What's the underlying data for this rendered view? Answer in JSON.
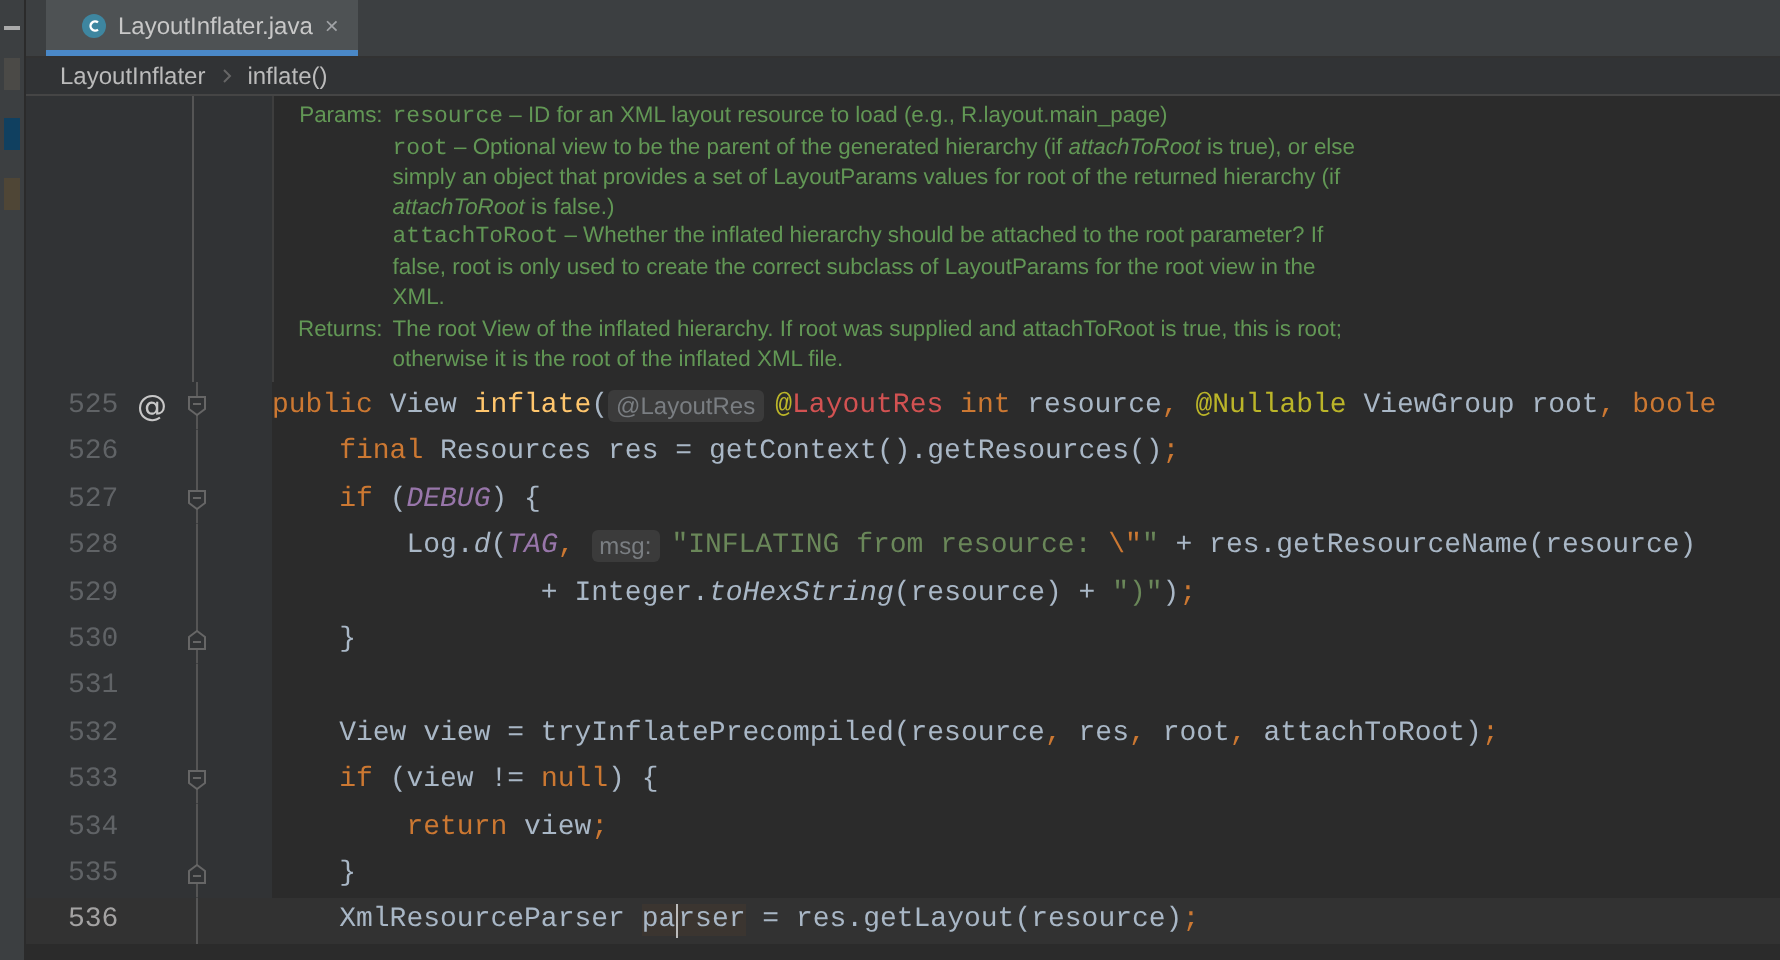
{
  "tab": {
    "title": "LayoutInflater.java",
    "close": "×",
    "selected": true
  },
  "breadcrumb": [
    "LayoutInflater",
    "inflate()"
  ],
  "doc": {
    "sections": [
      {
        "label": "Params:",
        "params": [
          {
            "name": "resource",
            "text": "– ID for an XML layout resource to load (e.g., R.layout.main_page)"
          },
          {
            "name": "root",
            "text": "– Optional view to be the parent of the generated hierarchy (if *attachToRoot* is true), or else simply an object that provides a set of LayoutParams values for root of the returned hierarchy (if *attachToRoot* is false.)"
          },
          {
            "name": "attachToRoot",
            "text": "– Whether the inflated hierarchy should be attached to the root parameter? If false, root is only used to create the correct subclass of LayoutParams for the root view in the XML."
          }
        ]
      },
      {
        "label": "Returns:",
        "params": [
          {
            "text": "The root View of the inflated hierarchy. If root was supplied and attachToRoot is true, this is root; otherwise it is the root of the inflated XML file."
          }
        ]
      }
    ]
  },
  "lines": [
    {
      "number": "525",
      "mark": "@",
      "fold_open": true,
      "fold_close": false,
      "current": false,
      "tokens": [
        {
          "text": "public ",
          "kind": "keyword"
        },
        {
          "text": "View ",
          "kind": "plain"
        },
        {
          "text": "inflate",
          "kind": "declaration"
        },
        {
          "text": "(",
          "kind": "plain"
        },
        {
          "text": "@LayoutRes",
          "kind": "hint"
        },
        {
          "text": "@",
          "kind": "annotation"
        },
        {
          "text": "LayoutRes",
          "kind": "resource-annotation"
        },
        {
          "text": " int ",
          "kind": "keyword"
        },
        {
          "text": "resource",
          "kind": "plain"
        },
        {
          "text": ", ",
          "kind": "keyword"
        },
        {
          "text": "@Nullable",
          "kind": "annotation"
        },
        {
          "text": " ViewGroup root",
          "kind": "plain"
        },
        {
          "text": ", boole",
          "kind": "keyword"
        }
      ]
    },
    {
      "number": "526",
      "fold_open": false,
      "fold_close": false,
      "current": false,
      "tokens": [
        {
          "text": "    final ",
          "kind": "keyword"
        },
        {
          "text": "Resources res = getContext().getResources()",
          "kind": "plain"
        },
        {
          "text": ";",
          "kind": "keyword"
        }
      ]
    },
    {
      "number": "527",
      "fold_open": true,
      "fold_close": false,
      "current": false,
      "tokens": [
        {
          "text": "    if ",
          "kind": "keyword"
        },
        {
          "text": "(",
          "kind": "plain"
        },
        {
          "text": "DEBUG",
          "kind": "constant"
        },
        {
          "text": ") {",
          "kind": "plain"
        }
      ]
    },
    {
      "number": "528",
      "fold_open": false,
      "fold_close": false,
      "current": false,
      "tokens": [
        {
          "text": "        Log.",
          "kind": "plain"
        },
        {
          "text": "d",
          "kind": "static"
        },
        {
          "text": "(",
          "kind": "plain"
        },
        {
          "text": "TAG",
          "kind": "constant"
        },
        {
          "text": ", ",
          "kind": "keyword"
        },
        {
          "text": "msg:",
          "kind": "hint"
        },
        {
          "text": "\"INFLATING from resource: ",
          "kind": "string"
        },
        {
          "text": "\\\"",
          "kind": "escape"
        },
        {
          "text": "\"",
          "kind": "string"
        },
        {
          "text": " + res.getResourceName(resource)",
          "kind": "plain"
        }
      ]
    },
    {
      "number": "529",
      "fold_open": false,
      "fold_close": false,
      "current": false,
      "tokens": [
        {
          "text": "                + Integer.",
          "kind": "plain"
        },
        {
          "text": "toHexString",
          "kind": "static"
        },
        {
          "text": "(resource) + ",
          "kind": "plain"
        },
        {
          "text": "\")\"",
          "kind": "string"
        },
        {
          "text": ")",
          "kind": "plain"
        },
        {
          "text": ";",
          "kind": "keyword"
        }
      ]
    },
    {
      "number": "530",
      "fold_open": false,
      "fold_close": true,
      "current": false,
      "tokens": [
        {
          "text": "    }",
          "kind": "plain"
        }
      ]
    },
    {
      "number": "531",
      "fold_open": false,
      "fold_close": false,
      "current": false
    },
    {
      "number": "532",
      "fold_open": false,
      "fold_close": false,
      "current": false,
      "tokens": [
        {
          "text": "    View view = tryInflatePrecompiled(resource",
          "kind": "plain"
        },
        {
          "text": ", ",
          "kind": "keyword"
        },
        {
          "text": "res",
          "kind": "plain"
        },
        {
          "text": ", ",
          "kind": "keyword"
        },
        {
          "text": "root",
          "kind": "plain"
        },
        {
          "text": ", ",
          "kind": "keyword"
        },
        {
          "text": "attachToRoot)",
          "kind": "plain"
        },
        {
          "text": ";",
          "kind": "keyword"
        }
      ]
    },
    {
      "number": "533",
      "fold_open": true,
      "fold_close": false,
      "current": false,
      "tokens": [
        {
          "text": "    if ",
          "kind": "keyword"
        },
        {
          "text": "(view != ",
          "kind": "plain"
        },
        {
          "text": "null",
          "kind": "keyword"
        },
        {
          "text": ") {",
          "kind": "plain"
        }
      ]
    },
    {
      "number": "534",
      "fold_open": false,
      "fold_close": false,
      "current": false,
      "tokens": [
        {
          "text": "        return ",
          "kind": "keyword"
        },
        {
          "text": "view",
          "kind": "plain"
        },
        {
          "text": ";",
          "kind": "keyword"
        }
      ]
    },
    {
      "number": "535",
      "fold_open": false,
      "fold_close": true,
      "current": false,
      "tokens": [
        {
          "text": "    }",
          "kind": "plain"
        }
      ]
    },
    {
      "number": "536",
      "fold_open": false,
      "fold_close": false,
      "current": true,
      "tokens": [
        {
          "text": "    XmlResourceParser ",
          "kind": "plain"
        },
        {
          "text": "pa",
          "kind": "usage"
        },
        {
          "kind": "caret"
        },
        {
          "text": "rser",
          "kind": "usage"
        },
        {
          "text": " = res.getLayout(resource)",
          "kind": "plain"
        },
        {
          "text": ";",
          "kind": "keyword"
        }
      ]
    }
  ]
}
